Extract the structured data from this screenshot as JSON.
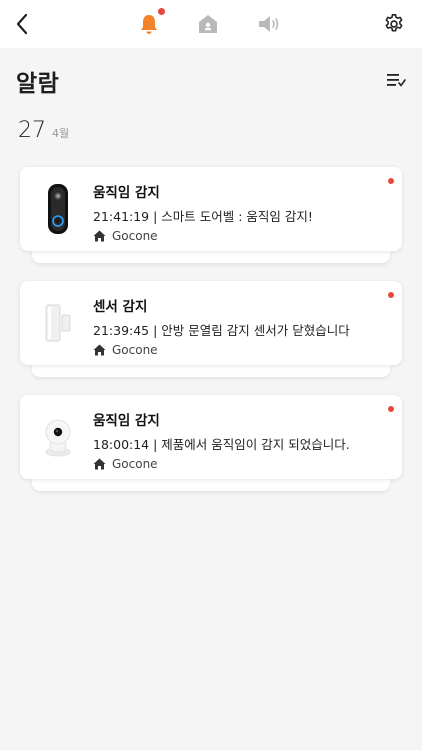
{
  "header": {
    "back_icon": "chevron-left-icon",
    "tabs": [
      {
        "name": "alarm",
        "icon": "bell-icon",
        "active": true,
        "badge": true
      },
      {
        "name": "home",
        "icon": "home-icon",
        "active": false
      },
      {
        "name": "sound",
        "icon": "speaker-icon",
        "active": false
      }
    ],
    "settings_icon": "gear-icon"
  },
  "page": {
    "title": "알람",
    "filter_icon": "list-check-icon"
  },
  "date": {
    "day": "27",
    "month": "4월"
  },
  "alarms": [
    {
      "title": "움직임 감지",
      "message": "21:41:19 | 스마트 도어벨 : 움직임 감지!",
      "location": "Gocone",
      "device": "doorbell",
      "unread": true
    },
    {
      "title": "센서 감지",
      "message": "21:39:45 | 안방 문열림 감지 센서가 닫혔습니다",
      "location": "Gocone",
      "device": "door-sensor",
      "unread": true
    },
    {
      "title": "움직임 감지",
      "message": "18:00:14 |  제품에서 움직임이 감지 되었습니다.",
      "location": "Gocone",
      "device": "camera",
      "unread": true
    }
  ],
  "colors": {
    "accent": "#f2832b",
    "unread": "#e8473c",
    "inactive_icon": "#b9b9b9"
  }
}
